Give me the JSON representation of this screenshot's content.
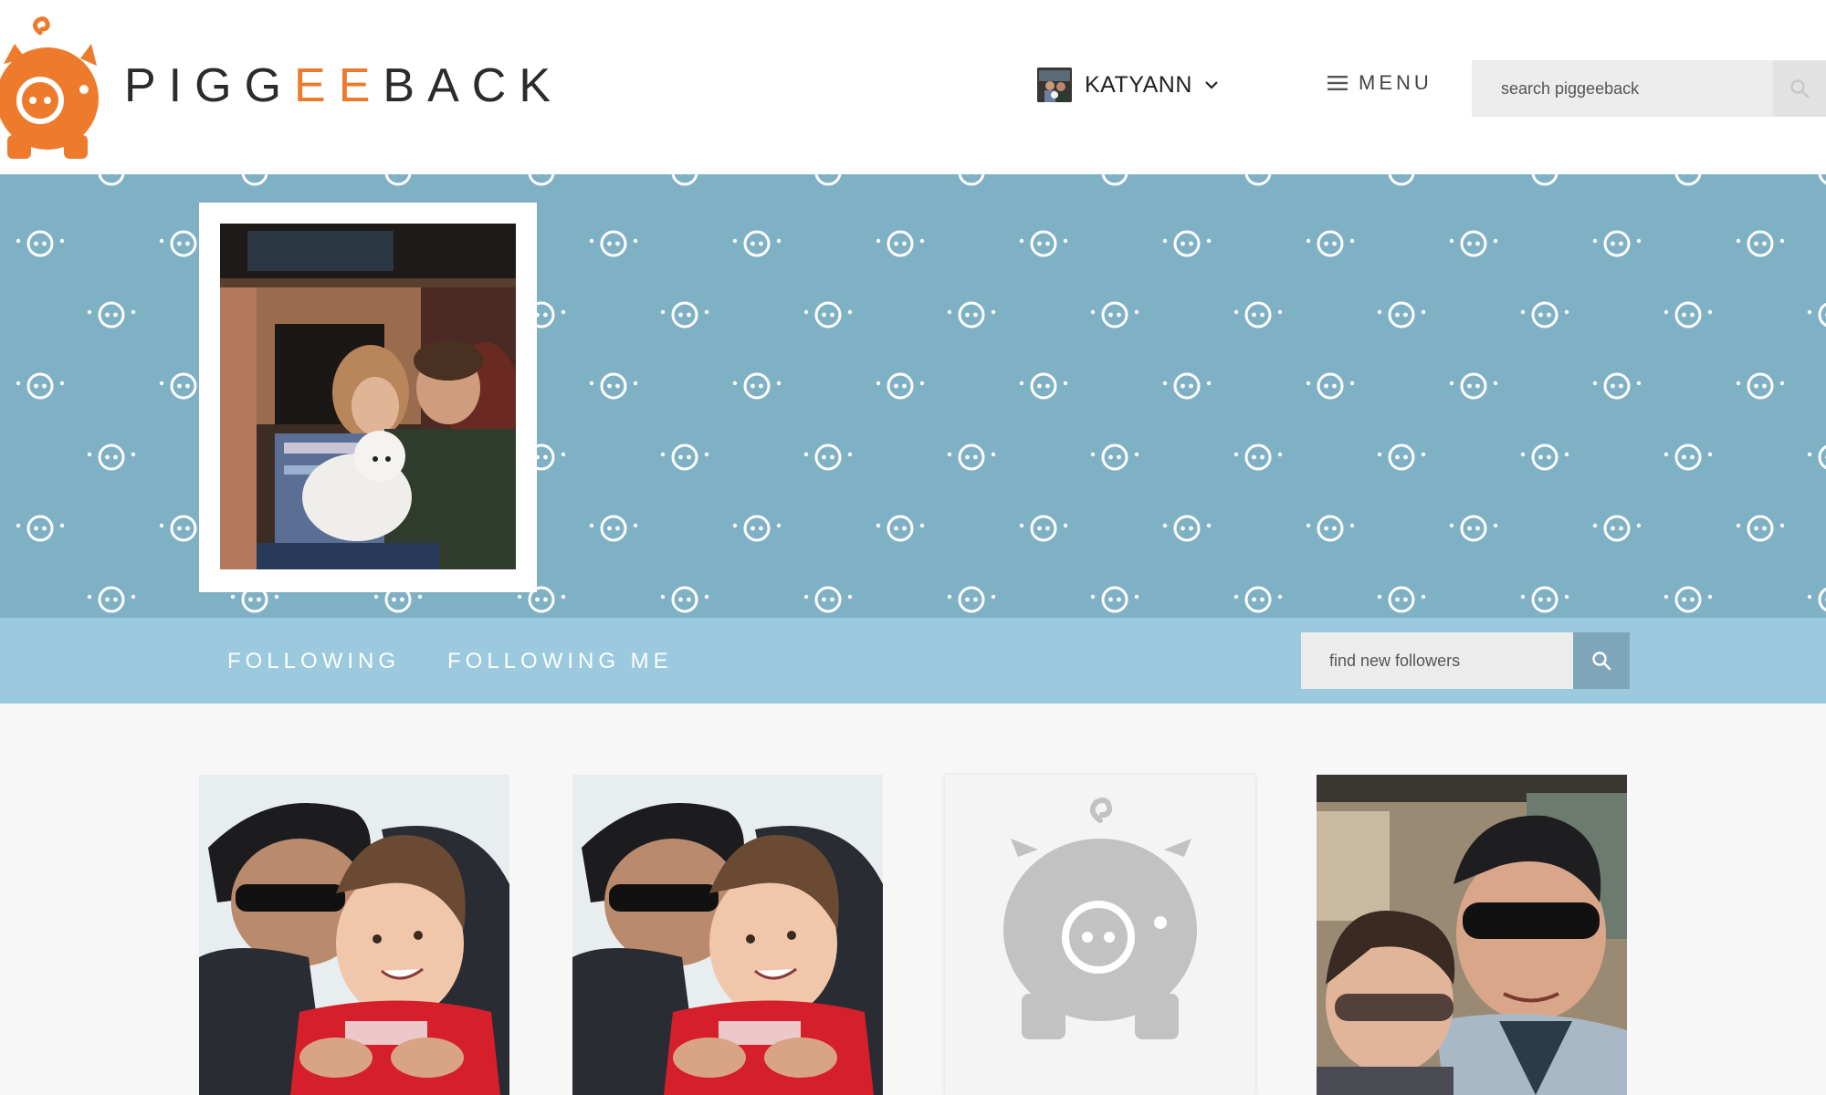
{
  "header": {
    "logo": {
      "part1": "PIGG",
      "part2": "EE",
      "part3": "BACK",
      "icon": "pig-logo-icon",
      "brand_color": "#ee7a2c"
    },
    "user": {
      "name": "KATYANN",
      "avatar_icon": "user-avatar",
      "dropdown_icon": "chevron-down-icon"
    },
    "menu": {
      "label": "MENU",
      "icon": "hamburger-icon"
    },
    "search": {
      "placeholder": "search piggeeback",
      "icon": "search-icon"
    }
  },
  "banner": {
    "pattern_icon": "pig-face-icon",
    "background_color": "#7fb1c5",
    "profile_photo": "profile-photo"
  },
  "subnav": {
    "tabs": [
      {
        "label": "FOLLOWING"
      },
      {
        "label": "FOLLOWING ME"
      }
    ],
    "find": {
      "placeholder": "find new followers",
      "icon": "search-icon"
    },
    "background_color": "#9bc9de"
  },
  "followers": [
    {
      "kind": "photo",
      "icon": "follower-photo"
    },
    {
      "kind": "photo",
      "icon": "follower-photo"
    },
    {
      "kind": "placeholder",
      "icon": "pig-placeholder-icon"
    },
    {
      "kind": "photo",
      "icon": "follower-photo"
    }
  ]
}
